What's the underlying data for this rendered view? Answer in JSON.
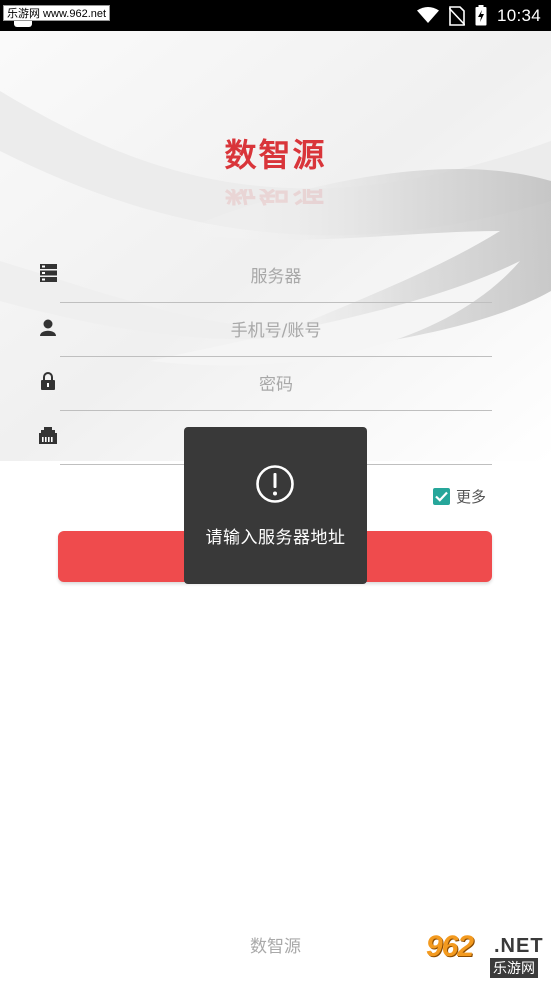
{
  "status_bar": {
    "watermark": "乐游网 www.962.net",
    "time": "10:34",
    "icons": [
      "wifi-icon",
      "no-sim-icon",
      "battery-charging-icon"
    ]
  },
  "app": {
    "logo_text": "数智源",
    "brand_color": "#d9353a"
  },
  "form": {
    "server": {
      "placeholder": "服务器",
      "value": "",
      "icon": "server-icon"
    },
    "account": {
      "placeholder": "手机号/账号",
      "value": "",
      "icon": "user-icon"
    },
    "password": {
      "placeholder": "密码",
      "value": "",
      "icon": "lock-icon"
    },
    "port": {
      "placeholder": "",
      "value": "",
      "icon": "ethernet-icon"
    },
    "more": {
      "label": "更多",
      "checked": true
    }
  },
  "login_button": {
    "label": "",
    "color": "#ef4b4d"
  },
  "toast": {
    "icon": "exclamation-icon",
    "message": "请输入服务器地址"
  },
  "footer": {
    "text": "数智源",
    "watermark_number": "962",
    "watermark_domain": ".NET",
    "watermark_site": "乐游网"
  }
}
